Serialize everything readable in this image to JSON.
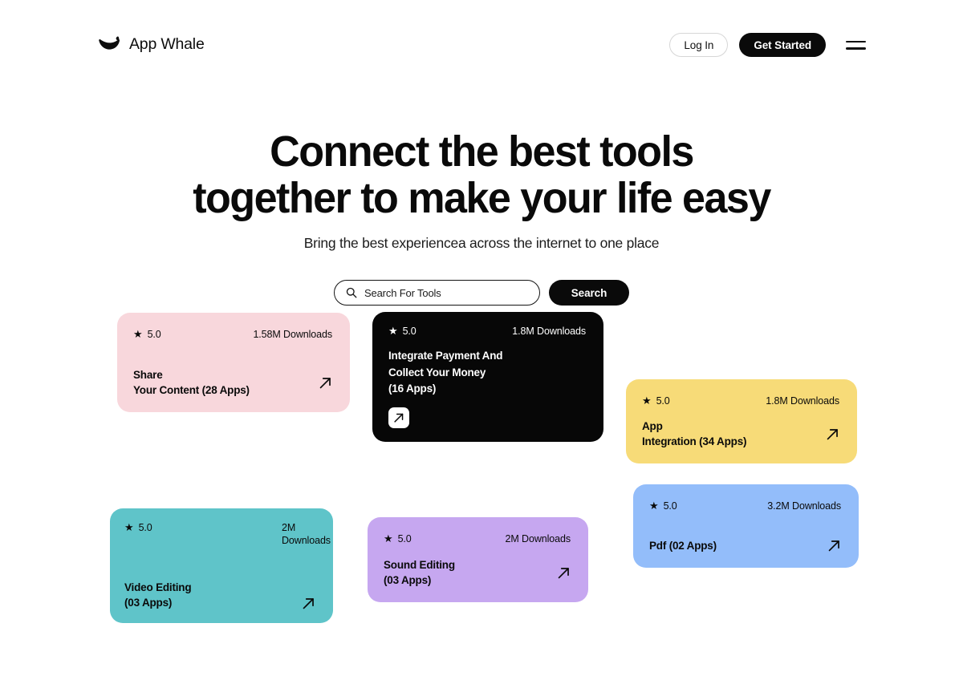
{
  "header": {
    "brand_name": "App Whale",
    "logo_icon": "whale-icon",
    "login_label": "Log In",
    "get_started_label": "Get Started",
    "menu_icon": "hamburger-menu-icon"
  },
  "hero": {
    "title_line1": "Connect the best tools",
    "title_line2": "together to make your life easy",
    "subtitle": "Bring the best experiencea across the internet to one place"
  },
  "search": {
    "icon": "search-icon",
    "value": "",
    "placeholder": "Search For Tools",
    "button_label": "Search"
  },
  "cards": [
    {
      "id": "share",
      "star": "★",
      "rating": "5.0",
      "downloads": "1.58M Downloads",
      "title": "Share\nYour Content (28 Apps)",
      "arrow_icon": "arrow-up-right-icon",
      "color": "#F8D7DC"
    },
    {
      "id": "payment",
      "star": "★",
      "rating": "5.0",
      "downloads": "1.8M Downloads",
      "title": "Integrate Payment And\nCollect Your Money\n(16 Apps)",
      "arrow_icon": "arrow-up-right-icon",
      "color": "#070707"
    },
    {
      "id": "integration",
      "star": "★",
      "rating": "5.0",
      "downloads": "1.8M Downloads",
      "title": "App\nIntegration (34 Apps)",
      "arrow_icon": "arrow-up-right-icon",
      "color": "#F7DB78"
    },
    {
      "id": "pdf",
      "star": "★",
      "rating": "5.0",
      "downloads": "3.2M Downloads",
      "title": "Pdf (02 Apps)",
      "arrow_icon": "arrow-up-right-icon",
      "color": "#93BDFA"
    },
    {
      "id": "video",
      "star": "★",
      "rating": "5.0",
      "downloads": "2M Downloads",
      "title": "Video Editing\n(03 Apps)",
      "arrow_icon": "arrow-up-right-icon",
      "color": "#5FC4C9"
    },
    {
      "id": "sound",
      "star": "★",
      "rating": "5.0",
      "downloads": "2M Downloads",
      "title": "Sound Editing\n(03 Apps)",
      "arrow_icon": "arrow-up-right-icon",
      "color": "#C6A7F0"
    }
  ]
}
